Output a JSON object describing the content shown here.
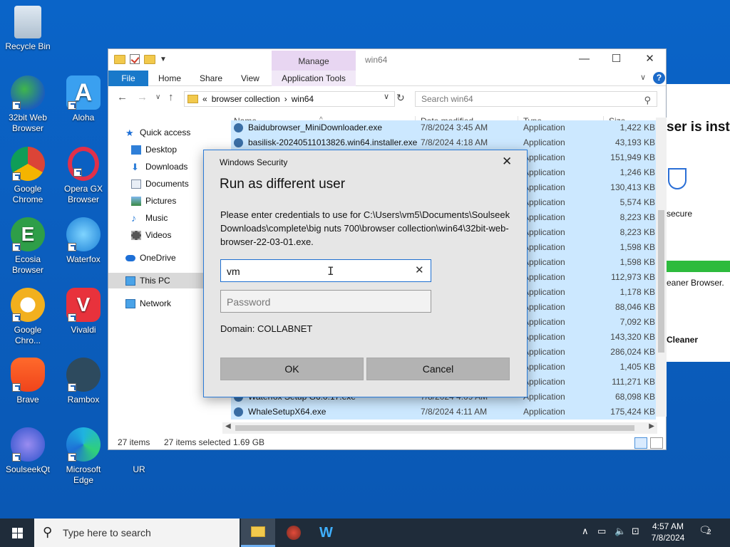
{
  "desktop": {
    "icons": [
      {
        "label": "Recycle Bin"
      },
      {
        "label": "32bit Web Browser"
      },
      {
        "label": "Aloha"
      },
      {
        "label": "Google Chrome"
      },
      {
        "label": "Opera GX Browser"
      },
      {
        "label": "Ecosia Browser"
      },
      {
        "label": "Waterfox"
      },
      {
        "label": "Google Chro..."
      },
      {
        "label": "Vivaldi"
      },
      {
        "label": "Brave"
      },
      {
        "label": "Rambox"
      },
      {
        "label": "SoulseekQt"
      },
      {
        "label": "Microsoft Edge"
      },
      {
        "label": "UR"
      }
    ]
  },
  "installer": {
    "heading": "ser is insta",
    "secure": "secure",
    "line2": "eaner Browser.",
    "line3": "Cleaner"
  },
  "explorer": {
    "window_title": "win64",
    "manage_tab": "Manage",
    "ribbon": {
      "file": "File",
      "home": "Home",
      "share": "Share",
      "view": "View",
      "app_tools": "Application Tools"
    },
    "address": {
      "prefix": "«",
      "crumb1": "browser collection",
      "sep": "›",
      "crumb2": "win64"
    },
    "search_placeholder": "Search win64",
    "nav": {
      "quick_access": "Quick access",
      "desktop": "Desktop",
      "downloads": "Downloads",
      "documents": "Documents",
      "pictures": "Pictures",
      "music": "Music",
      "videos": "Videos",
      "onedrive": "OneDrive",
      "thispc": "This PC",
      "network": "Network"
    },
    "columns": {
      "name": "Name",
      "date": "Date modified",
      "type": "Type",
      "size": "Size"
    },
    "rows": [
      {
        "name": "Baidubrowser_MiniDownloader.exe",
        "date": "7/8/2024 3:45 AM",
        "type": "Application",
        "size": "1,422 KB"
      },
      {
        "name": "basilisk-20240511013826.win64.installer.exe",
        "date": "7/8/2024 4:18 AM",
        "type": "Application",
        "size": "43,193 KB"
      },
      {
        "name": "",
        "date": "",
        "type": "Application",
        "size": "151,949 KB"
      },
      {
        "name": "",
        "date": "",
        "type": "Application",
        "size": "1,246 KB"
      },
      {
        "name": "",
        "date": "",
        "type": "Application",
        "size": "130,413 KB"
      },
      {
        "name": "",
        "date": "",
        "type": "Application",
        "size": "5,574 KB"
      },
      {
        "name": "",
        "date": "",
        "type": "Application",
        "size": "8,223 KB"
      },
      {
        "name": "",
        "date": "",
        "type": "Application",
        "size": "8,223 KB"
      },
      {
        "name": "",
        "date": "",
        "type": "Application",
        "size": "1,598 KB"
      },
      {
        "name": "",
        "date": "",
        "type": "Application",
        "size": "1,598 KB"
      },
      {
        "name": "",
        "date": "",
        "type": "Application",
        "size": "112,973 KB"
      },
      {
        "name": "",
        "date": "",
        "type": "Application",
        "size": "1,178 KB"
      },
      {
        "name": "",
        "date": "",
        "type": "Application",
        "size": "88,046 KB"
      },
      {
        "name": "",
        "date": "",
        "type": "Application",
        "size": "7,092 KB"
      },
      {
        "name": "",
        "date": "",
        "type": "Application",
        "size": "143,320 KB"
      },
      {
        "name": "",
        "date": "",
        "type": "Application",
        "size": "286,024 KB"
      },
      {
        "name": "",
        "date": "",
        "type": "Application",
        "size": "1,405 KB"
      },
      {
        "name": "",
        "date": "",
        "type": "Application",
        "size": "111,271 KB"
      },
      {
        "name": "Waterfox Setup G6.0.17.exe",
        "date": "7/8/2024 4:09 AM",
        "type": "Application",
        "size": "68,098 KB"
      },
      {
        "name": "WhaleSetupX64.exe",
        "date": "7/8/2024 4:11 AM",
        "type": "Application",
        "size": "175,424 KB"
      }
    ],
    "status": {
      "items": "27 items",
      "selected": "27 items selected",
      "size": "1.69 GB"
    }
  },
  "dialog": {
    "caption": "Windows Security",
    "title": "Run as different user",
    "message": "Please enter credentials to use for C:\\Users\\vm5\\Documents\\Soulseek Downloads\\complete\\big nuts 700\\browser collection\\win64\\32bit-web-browser-22-03-01.exe.",
    "username_value": "vm",
    "password_placeholder": "Password",
    "domain": "Domain: COLLABNET",
    "ok": "OK",
    "cancel": "Cancel"
  },
  "taskbar": {
    "search_placeholder": "Type here to search",
    "time": "4:57 AM",
    "date": "7/8/2024",
    "notifications": "2"
  }
}
